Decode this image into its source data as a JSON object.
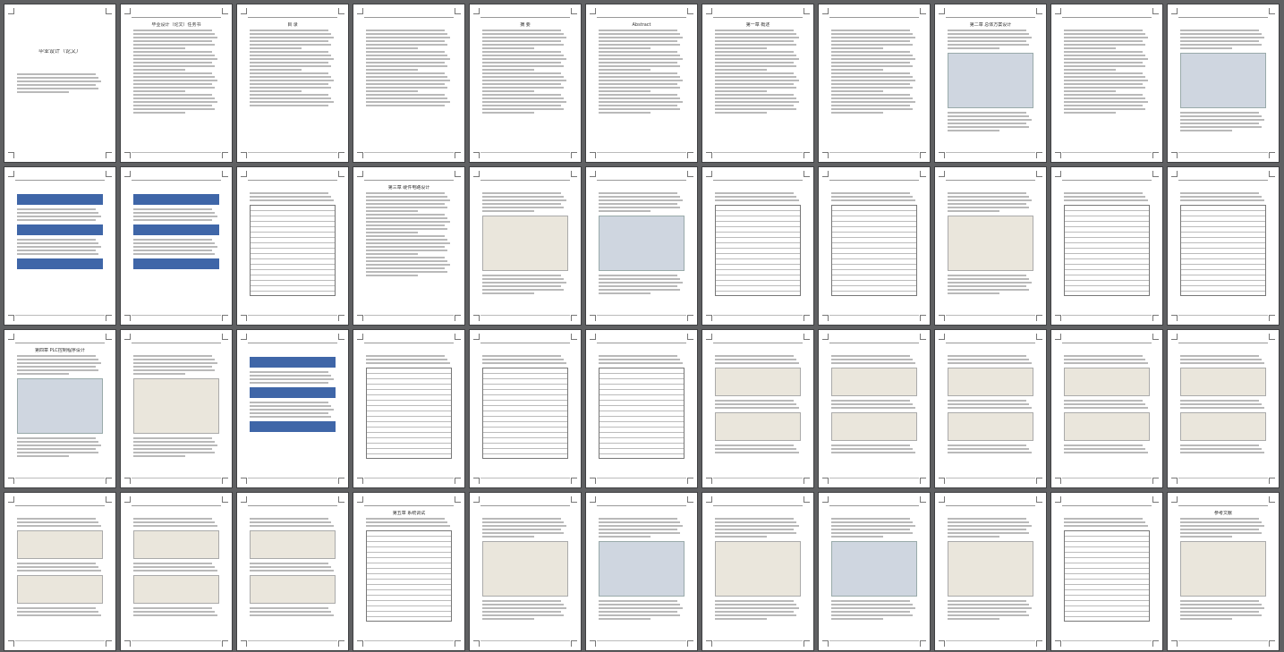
{
  "document": {
    "view": "page-grid",
    "columns": 11,
    "rows": 4
  },
  "pages": [
    {
      "id": 1,
      "kind": "cover",
      "title": "毕业设计（论文）"
    },
    {
      "id": 2,
      "kind": "text",
      "title": "毕业设计（论文）任务书"
    },
    {
      "id": 3,
      "kind": "toc",
      "title": "目 录"
    },
    {
      "id": 4,
      "kind": "toc",
      "title": ""
    },
    {
      "id": 5,
      "kind": "text",
      "title": "摘 要"
    },
    {
      "id": 6,
      "kind": "text",
      "title": "Abstract"
    },
    {
      "id": 7,
      "kind": "text",
      "title": "第一章 概述"
    },
    {
      "id": 8,
      "kind": "text",
      "title": ""
    },
    {
      "id": 9,
      "kind": "figure",
      "title": "第二章 总体方案设计"
    },
    {
      "id": 10,
      "kind": "text",
      "title": ""
    },
    {
      "id": 11,
      "kind": "figure",
      "title": ""
    },
    {
      "id": 12,
      "kind": "flow",
      "title": ""
    },
    {
      "id": 13,
      "kind": "flow",
      "title": ""
    },
    {
      "id": 14,
      "kind": "table",
      "title": ""
    },
    {
      "id": 15,
      "kind": "text",
      "title": "第三章 硬件电路设计"
    },
    {
      "id": 16,
      "kind": "figure",
      "title": ""
    },
    {
      "id": 17,
      "kind": "figure",
      "title": ""
    },
    {
      "id": 18,
      "kind": "table",
      "title": ""
    },
    {
      "id": 19,
      "kind": "table",
      "title": ""
    },
    {
      "id": 20,
      "kind": "figure",
      "title": ""
    },
    {
      "id": 21,
      "kind": "table",
      "title": ""
    },
    {
      "id": 22,
      "kind": "table",
      "title": ""
    },
    {
      "id": 23,
      "kind": "figure",
      "title": "第四章 PLC控制程序设计"
    },
    {
      "id": 24,
      "kind": "figure",
      "title": ""
    },
    {
      "id": 25,
      "kind": "flow",
      "title": ""
    },
    {
      "id": 26,
      "kind": "table",
      "title": ""
    },
    {
      "id": 27,
      "kind": "table",
      "title": ""
    },
    {
      "id": 28,
      "kind": "table",
      "title": ""
    },
    {
      "id": 29,
      "kind": "ladder",
      "title": ""
    },
    {
      "id": 30,
      "kind": "ladder",
      "title": ""
    },
    {
      "id": 31,
      "kind": "ladder",
      "title": ""
    },
    {
      "id": 32,
      "kind": "ladder",
      "title": ""
    },
    {
      "id": 33,
      "kind": "ladder",
      "title": ""
    },
    {
      "id": 34,
      "kind": "ladder",
      "title": ""
    },
    {
      "id": 35,
      "kind": "ladder",
      "title": ""
    },
    {
      "id": 36,
      "kind": "ladder",
      "title": ""
    },
    {
      "id": 37,
      "kind": "table",
      "title": "第五章 系统调试"
    },
    {
      "id": 38,
      "kind": "figure",
      "title": ""
    },
    {
      "id": 39,
      "kind": "figure",
      "title": ""
    },
    {
      "id": 40,
      "kind": "figure",
      "title": ""
    },
    {
      "id": 41,
      "kind": "figure",
      "title": ""
    },
    {
      "id": 42,
      "kind": "figure",
      "title": ""
    },
    {
      "id": 43,
      "kind": "table",
      "title": ""
    },
    {
      "id": 44,
      "kind": "figure",
      "title": "参考文献"
    }
  ],
  "colors": {
    "background": "#5f6062",
    "page": "#ffffff",
    "flowchart": "#3f66a8"
  }
}
